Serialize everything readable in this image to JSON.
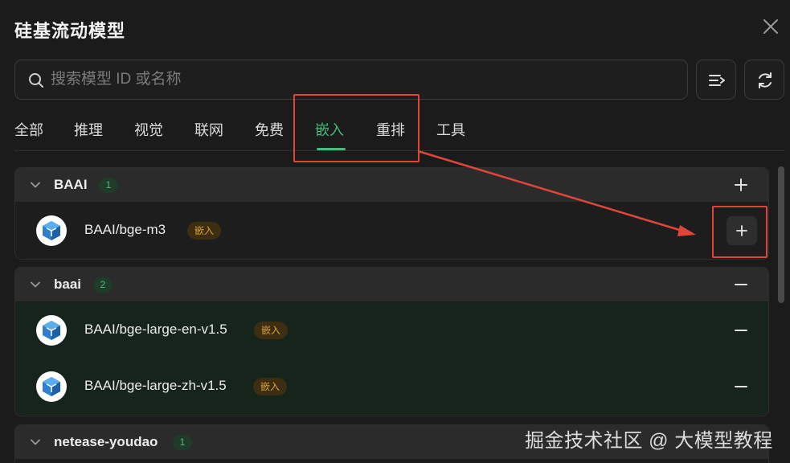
{
  "dialog": {
    "title": "硅基流动模型"
  },
  "search": {
    "placeholder": "搜索模型 ID 或名称",
    "value": ""
  },
  "tabs": [
    {
      "label": "全部"
    },
    {
      "label": "推理"
    },
    {
      "label": "视觉"
    },
    {
      "label": "联网"
    },
    {
      "label": "免费"
    },
    {
      "label": "嵌入"
    },
    {
      "label": "重排"
    },
    {
      "label": "工具"
    }
  ],
  "active_tab": "嵌入",
  "groups": [
    {
      "name": "BAAI",
      "count": "1",
      "action": "add",
      "models": [
        {
          "name": "BAAI/bge-m3",
          "tag": "嵌入",
          "action": "add"
        }
      ]
    },
    {
      "name": "baai",
      "count": "2",
      "action": "remove",
      "models": [
        {
          "name": "BAAI/bge-large-en-v1.5",
          "tag": "嵌入",
          "action": "remove"
        },
        {
          "name": "BAAI/bge-large-zh-v1.5",
          "tag": "嵌入",
          "action": "remove"
        }
      ]
    },
    {
      "name": "netease-youdao",
      "count": "1",
      "action": "",
      "models": []
    }
  ],
  "watermark": "掘金技术社区 @ 大模型教程",
  "colors": {
    "accent_green": "#3fbf7a",
    "tag_orange": "#d9a23c",
    "annotation_red": "#e0453c",
    "background": "#1b1b1b"
  },
  "icons": {
    "close": "close-icon",
    "search": "search-icon",
    "sort": "sort-list-icon",
    "refresh": "refresh-icon",
    "chevron": "chevron-down-icon",
    "add": "plus-icon",
    "remove": "minus-icon",
    "model": "baai-cube-icon"
  }
}
